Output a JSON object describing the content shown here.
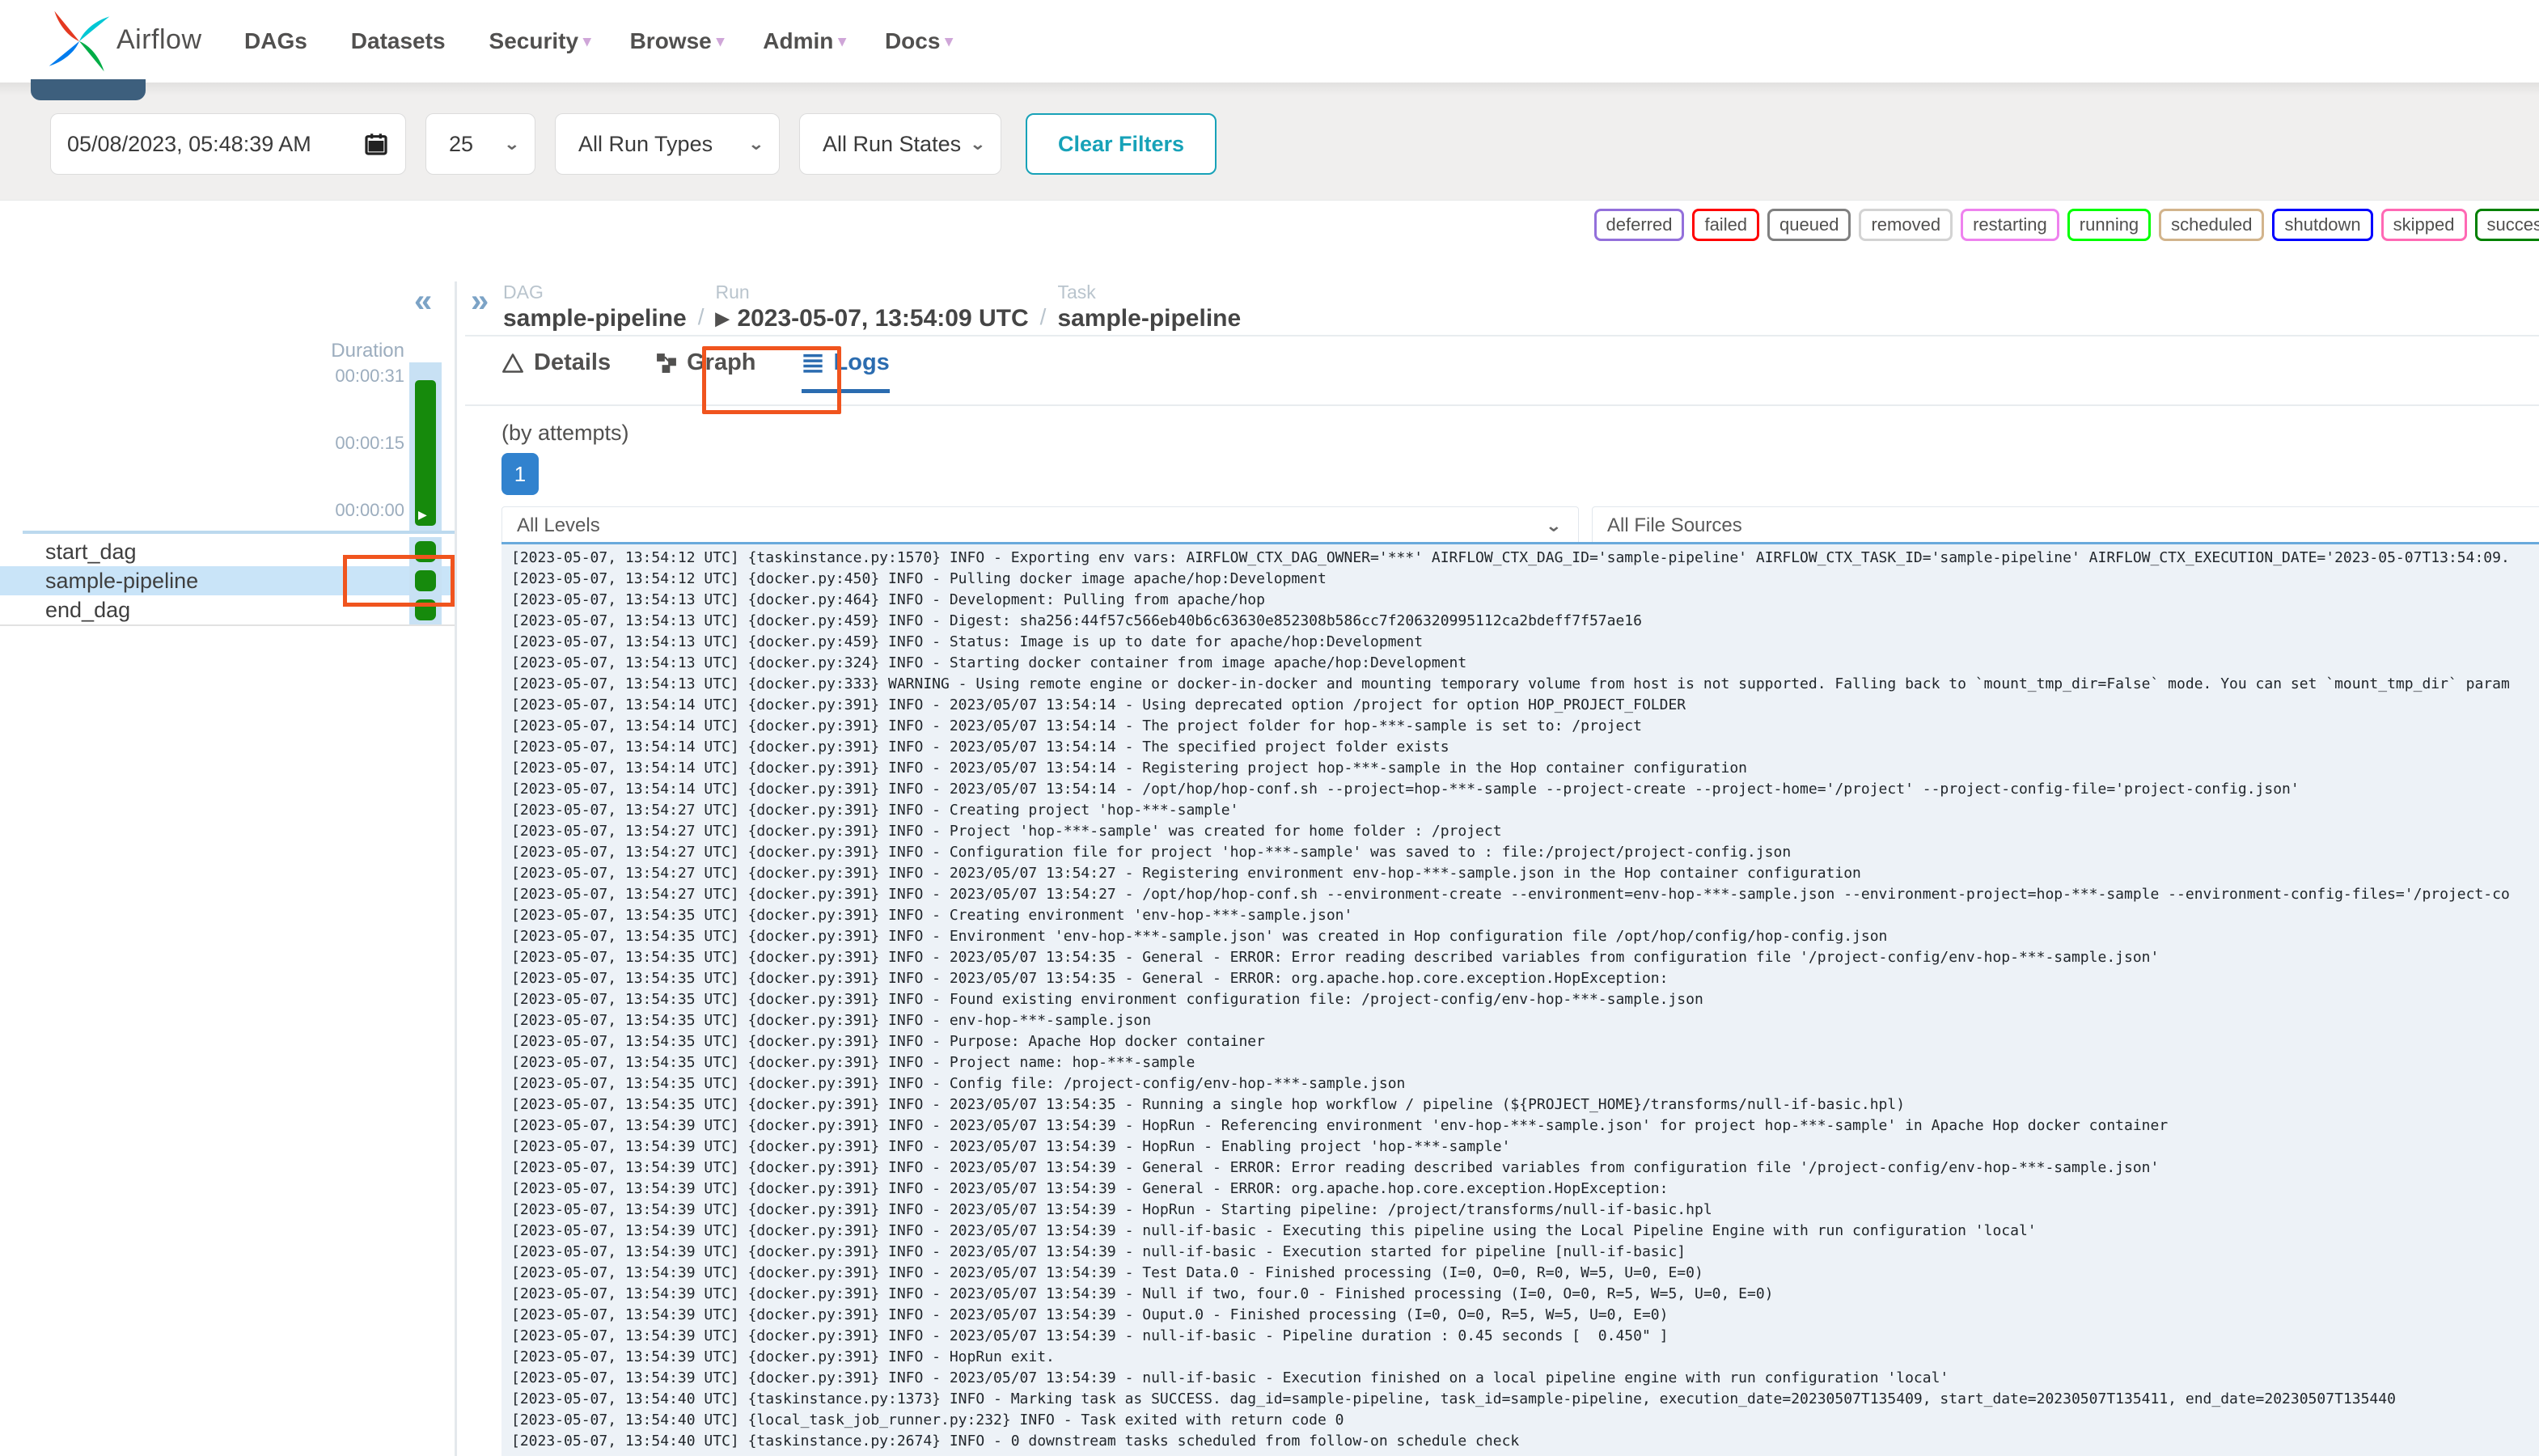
{
  "navbar": {
    "brand": "Airflow",
    "items": [
      {
        "label": "DAGs",
        "caret": ""
      },
      {
        "label": "Datasets",
        "caret": ""
      },
      {
        "label": "Security",
        "caret": "▾"
      },
      {
        "label": "Browse",
        "caret": "▾"
      },
      {
        "label": "Admin",
        "caret": "▾"
      },
      {
        "label": "Docs",
        "caret": "▾"
      }
    ]
  },
  "filters": {
    "datetime_value": "05/08/2023, 05:48:39 AM",
    "page_size": "25",
    "run_types": "All Run Types",
    "run_states": "All Run States",
    "clear_label": "Clear Filters",
    "chevron": "⌄"
  },
  "state_badges": [
    {
      "label": "deferred",
      "color": "mediumpurple"
    },
    {
      "label": "failed",
      "color": "red"
    },
    {
      "label": "queued",
      "color": "gray"
    },
    {
      "label": "removed",
      "color": "lightgrey"
    },
    {
      "label": "restarting",
      "color": "violet"
    },
    {
      "label": "running",
      "color": "lime"
    },
    {
      "label": "scheduled",
      "color": "tan"
    },
    {
      "label": "shutdown",
      "color": "blue"
    },
    {
      "label": "skipped",
      "color": "hotpink"
    },
    {
      "label": "success",
      "color": "green"
    }
  ],
  "sidebar": {
    "collapse_icon": "«",
    "duration_label": "Duration",
    "ticks": [
      "00:00:31",
      "00:00:15",
      "00:00:00"
    ],
    "bar_play_icon": "▶",
    "tasks": [
      {
        "name": "start_dag",
        "row_class": ""
      },
      {
        "name": "sample-pipeline",
        "row_class": "selected"
      },
      {
        "name": "end_dag",
        "row_class": ""
      }
    ]
  },
  "breadcrumb": {
    "expand_icon": "»",
    "dag_label": "DAG",
    "dag_value": "sample-pipeline",
    "run_label": "Run",
    "run_play_icon": "▶",
    "run_value": "2023-05-07, 13:54:09 UTC",
    "task_label": "Task",
    "task_value": "sample-pipeline",
    "separator": "/"
  },
  "tabs": {
    "details": "Details",
    "graph": "Graph",
    "logs": "Logs"
  },
  "logs_panel": {
    "by_attempts": "(by attempts)",
    "attempt": "1",
    "levels_filter": "All Levels",
    "file_sources_filter": "All File Sources",
    "chevron": "⌄",
    "lines": [
      "[2023-05-07, 13:54:12 UTC] {taskinstance.py:1570} INFO - Exporting env vars: AIRFLOW_CTX_DAG_OWNER='***' AIRFLOW_CTX_DAG_ID='sample-pipeline' AIRFLOW_CTX_TASK_ID='sample-pipeline' AIRFLOW_CTX_EXECUTION_DATE='2023-05-07T13:54:09.",
      "[2023-05-07, 13:54:12 UTC] {docker.py:450} INFO - Pulling docker image apache/hop:Development",
      "[2023-05-07, 13:54:13 UTC] {docker.py:464} INFO - Development: Pulling from apache/hop",
      "[2023-05-07, 13:54:13 UTC] {docker.py:459} INFO - Digest: sha256:44f57c566eb40b6c63630e852308b586cc7f206320995112ca2bdeff7f57ae16",
      "[2023-05-07, 13:54:13 UTC] {docker.py:459} INFO - Status: Image is up to date for apache/hop:Development",
      "[2023-05-07, 13:54:13 UTC] {docker.py:324} INFO - Starting docker container from image apache/hop:Development",
      "[2023-05-07, 13:54:13 UTC] {docker.py:333} WARNING - Using remote engine or docker-in-docker and mounting temporary volume from host is not supported. Falling back to `mount_tmp_dir=False` mode. You can set `mount_tmp_dir` param",
      "[2023-05-07, 13:54:14 UTC] {docker.py:391} INFO - 2023/05/07 13:54:14 - Using deprecated option /project for option HOP_PROJECT_FOLDER",
      "[2023-05-07, 13:54:14 UTC] {docker.py:391} INFO - 2023/05/07 13:54:14 - The project folder for hop-***-sample is set to: /project",
      "[2023-05-07, 13:54:14 UTC] {docker.py:391} INFO - 2023/05/07 13:54:14 - The specified project folder exists",
      "[2023-05-07, 13:54:14 UTC] {docker.py:391} INFO - 2023/05/07 13:54:14 - Registering project hop-***-sample in the Hop container configuration",
      "[2023-05-07, 13:54:14 UTC] {docker.py:391} INFO - 2023/05/07 13:54:14 - /opt/hop/hop-conf.sh --project=hop-***-sample --project-create --project-home='/project' --project-config-file='project-config.json'",
      "[2023-05-07, 13:54:27 UTC] {docker.py:391} INFO - Creating project 'hop-***-sample'",
      "[2023-05-07, 13:54:27 UTC] {docker.py:391} INFO - Project 'hop-***-sample' was created for home folder : /project",
      "[2023-05-07, 13:54:27 UTC] {docker.py:391} INFO - Configuration file for project 'hop-***-sample' was saved to : file:/project/project-config.json",
      "[2023-05-07, 13:54:27 UTC] {docker.py:391} INFO - 2023/05/07 13:54:27 - Registering environment env-hop-***-sample.json in the Hop container configuration",
      "[2023-05-07, 13:54:27 UTC] {docker.py:391} INFO - 2023/05/07 13:54:27 - /opt/hop/hop-conf.sh --environment-create --environment=env-hop-***-sample.json --environment-project=hop-***-sample --environment-config-files='/project-co",
      "[2023-05-07, 13:54:35 UTC] {docker.py:391} INFO - Creating environment 'env-hop-***-sample.json'",
      "[2023-05-07, 13:54:35 UTC] {docker.py:391} INFO - Environment 'env-hop-***-sample.json' was created in Hop configuration file /opt/hop/config/hop-config.json",
      "[2023-05-07, 13:54:35 UTC] {docker.py:391} INFO - 2023/05/07 13:54:35 - General - ERROR: Error reading described variables from configuration file '/project-config/env-hop-***-sample.json'",
      "[2023-05-07, 13:54:35 UTC] {docker.py:391} INFO - 2023/05/07 13:54:35 - General - ERROR: org.apache.hop.core.exception.HopException:",
      "[2023-05-07, 13:54:35 UTC] {docker.py:391} INFO - Found existing environment configuration file: /project-config/env-hop-***-sample.json",
      "[2023-05-07, 13:54:35 UTC] {docker.py:391} INFO - env-hop-***-sample.json",
      "[2023-05-07, 13:54:35 UTC] {docker.py:391} INFO - Purpose: Apache Hop docker container",
      "[2023-05-07, 13:54:35 UTC] {docker.py:391} INFO - Project name: hop-***-sample",
      "[2023-05-07, 13:54:35 UTC] {docker.py:391} INFO - Config file: /project-config/env-hop-***-sample.json",
      "[2023-05-07, 13:54:35 UTC] {docker.py:391} INFO - 2023/05/07 13:54:35 - Running a single hop workflow / pipeline (${PROJECT_HOME}/transforms/null-if-basic.hpl)",
      "[2023-05-07, 13:54:39 UTC] {docker.py:391} INFO - 2023/05/07 13:54:39 - HopRun - Referencing environment 'env-hop-***-sample.json' for project hop-***-sample' in Apache Hop docker container",
      "[2023-05-07, 13:54:39 UTC] {docker.py:391} INFO - 2023/05/07 13:54:39 - HopRun - Enabling project 'hop-***-sample'",
      "[2023-05-07, 13:54:39 UTC] {docker.py:391} INFO - 2023/05/07 13:54:39 - General - ERROR: Error reading described variables from configuration file '/project-config/env-hop-***-sample.json'",
      "[2023-05-07, 13:54:39 UTC] {docker.py:391} INFO - 2023/05/07 13:54:39 - General - ERROR: org.apache.hop.core.exception.HopException:",
      "[2023-05-07, 13:54:39 UTC] {docker.py:391} INFO - 2023/05/07 13:54:39 - HopRun - Starting pipeline: /project/transforms/null-if-basic.hpl",
      "[2023-05-07, 13:54:39 UTC] {docker.py:391} INFO - 2023/05/07 13:54:39 - null-if-basic - Executing this pipeline using the Local Pipeline Engine with run configuration 'local'",
      "[2023-05-07, 13:54:39 UTC] {docker.py:391} INFO - 2023/05/07 13:54:39 - null-if-basic - Execution started for pipeline [null-if-basic]",
      "[2023-05-07, 13:54:39 UTC] {docker.py:391} INFO - 2023/05/07 13:54:39 - Test Data.0 - Finished processing (I=0, O=0, R=0, W=5, U=0, E=0)",
      "[2023-05-07, 13:54:39 UTC] {docker.py:391} INFO - 2023/05/07 13:54:39 - Null if two, four.0 - Finished processing (I=0, O=0, R=5, W=5, U=0, E=0)",
      "[2023-05-07, 13:54:39 UTC] {docker.py:391} INFO - 2023/05/07 13:54:39 - Ouput.0 - Finished processing (I=0, O=0, R=5, W=5, U=0, E=0)",
      "[2023-05-07, 13:54:39 UTC] {docker.py:391} INFO - 2023/05/07 13:54:39 - null-if-basic - Pipeline duration : 0.45 seconds [  0.450\" ]",
      "[2023-05-07, 13:54:39 UTC] {docker.py:391} INFO - HopRun exit.",
      "[2023-05-07, 13:54:39 UTC] {docker.py:391} INFO - 2023/05/07 13:54:39 - null-if-basic - Execution finished on a local pipeline engine with run configuration 'local'",
      "[2023-05-07, 13:54:40 UTC] {taskinstance.py:1373} INFO - Marking task as SUCCESS. dag_id=sample-pipeline, task_id=sample-pipeline, execution_date=20230507T135409, start_date=20230507T135411, end_date=20230507T135440",
      "[2023-05-07, 13:54:40 UTC] {local_task_job_runner.py:232} INFO - Task exited with return code 0",
      "[2023-05-07, 13:54:40 UTC] {taskinstance.py:2674} INFO - 0 downstream tasks scheduled from follow-on schedule check"
    ]
  }
}
